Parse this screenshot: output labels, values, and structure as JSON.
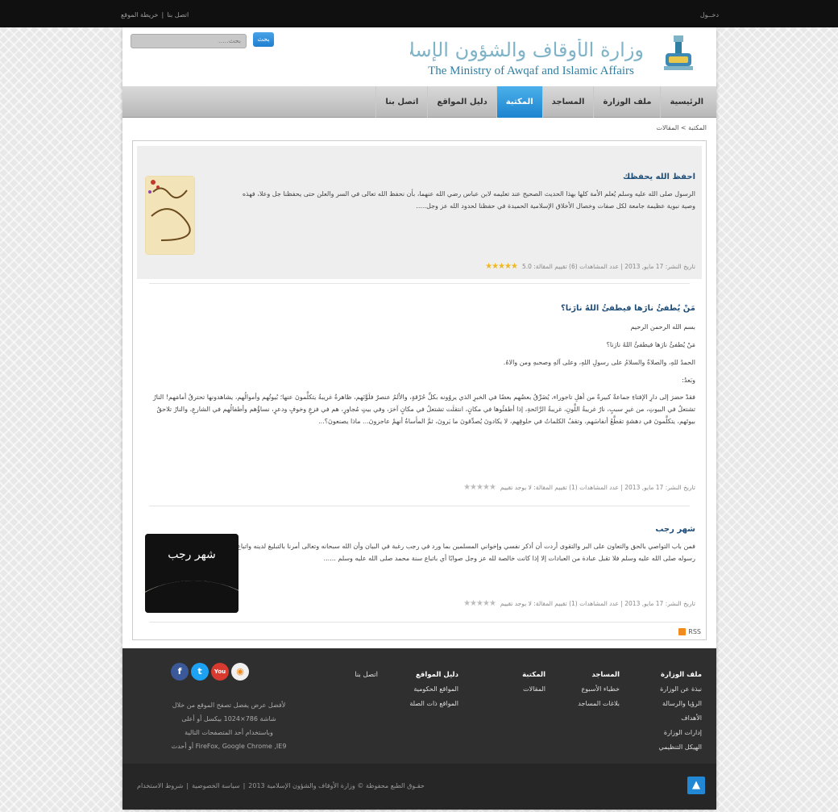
{
  "topbar": {
    "login": "دخــول",
    "links": [
      "اتصل بنا",
      "|",
      "خريطة الموقع"
    ]
  },
  "header": {
    "logo_ar": "وزارة الأوقاف والشؤون الإسلامية",
    "logo_en": "The Ministry of Awqaf and Islamic Affairs",
    "search_placeholder": "بحث.....",
    "search_button": "بحث"
  },
  "nav": {
    "items": [
      "الرئيسية",
      "ملف الوزارة",
      "المساجد",
      "المكتبة",
      "دليل المواقع",
      "اتصل بنا"
    ],
    "active_index": 3
  },
  "breadcrumb": "المكتبة > المقالات",
  "articles": [
    {
      "title": "احفظ الله يحفظك",
      "excerpt": "الرسول صلى الله عليه وسلم يُعلم الأمة كلها بهذا الحديث الصحيح عند تعليمه لابن عباس رضي الله عنهما، بأن نحفظ الله تعالى في السر والعلن حتى يحفظنا جل وعلا، فهذه وصية نبوية عظيمة جامعة لكل صفات وخصال الأخلاق الإسلامية الحميدة في حفظنا لحدود الله عز وجل.....",
      "meta": "تاريخ النشر: 17 مايو, 2013   |   عدد المشاهدات (6)   تقييم المقالة: 5.0",
      "rating": 5.0,
      "image_caption": "احفظ الله يحفظك"
    },
    {
      "title": "مَنْ يُطفئُ نارَها فيطفئُ اللهُ نارَنا؟",
      "paragraphs": [
        "بسم الله الرحمن الرحيم",
        "مَنْ يُطفئُ نارَها فيطفئُ اللهُ نارَنا؟",
        "الحمدُ للهِ، والصلاةُ والسلامُ على رسولِ اللهِ، وعلى آلهِ وصحبهِ ومن والاهُ.",
        "وبَعدُ:",
        "فقدْ حضرَ إلى دارِ الإفتاءِ جماعةٌ كبيرةٌ من أهلِ تاجوراء، يُضَرِّقُ بعضُهم بعضًا في الخبرِ الذي يروُونه بكلِّ حُرْقةٍ، والألمُ عنصرٌ فلَوَّنَهم، ظاهرةُ غريبةُ يتكلَّمونَ عنها؛ بُيوتُهم وأموالُهم، يشاهدونها تحترقُ أمامَهم! النارُ تشتعلُ في البيوتِ، من غيرِ سببٍ، نارٌ غريبةُ اللَّونِ، غريبةُ الرَّائحةِ، إذا أطفئُوها في مكانٍ، انتقلَت تشتعلُ في مكانٍ آخرَ، وفي بيتٍ مُجاورٍ، هم في فزعٍ وخوفٍ ودعرٍ، نساؤُهم وأطفالُهم في الشارعِ، والنارُ تلاحقُ بيوتَهم، يتكلَّمونَ في دهشةٍ تقطَّعُ أنفاسَهم، وتقفُ الكلماتُ في حلوقِهم، لا يكادونَ يُصدِّقونَ ما يَرونَ، ثمَّ المأساةُ أنهمْ عاجزونَ... ماذا يصنعونَ؟..."
      ],
      "meta": "تاريخ النشر: 17 مايو, 2013   |   عدد المشاهدات (1)   تقييم المقالة: لا يوجد تقييم",
      "rating": 0
    },
    {
      "title": "شهر رجب",
      "excerpt": "فمن باب التواصي بالحق والتعاون على البر والتقوى أردت أن أذكر نفسي وإخواني المسلمين بما ورد في رجب رغبة في البيان وأن الله سبحانه وتعالى أمرنا بالتبليغ لدينه واتباع رسوله صلى الله عليه وسلم فلا تقبل عبادة من العبادات إلا إذا كانت خالصة لله عز وجل صوابًا أي باتباع سنة محمد صلى الله عليه وسلم ......",
      "meta": "تاريخ النشر: 17 مايو, 2013   |   عدد المشاهدات (1)   تقييم المقالة: لا يوجد تقييم",
      "rating": 0,
      "image_caption": "شهر رجب"
    }
  ],
  "rss": "RSS",
  "footer": {
    "columns": [
      {
        "title": "ملف الوزارة",
        "items": [
          "نبذة عن الوزارة",
          "الرؤيا والرسالة",
          "الأهداف",
          "إدارات الوزارة",
          "الهيكل التنظيمي"
        ]
      },
      {
        "title": "المساجد",
        "items": [
          "خطباء الأسبوع",
          "بلاغات المساجد"
        ]
      },
      {
        "title": "المكتبة",
        "items": [
          "المقالات"
        ]
      },
      {
        "title": "دليل المواقع",
        "items": [
          "المواقع الحكومية",
          "المواقع ذات الصلة"
        ]
      },
      {
        "title": "اتصل بنا",
        "items": []
      }
    ],
    "browser_note": [
      "لأفضل عرض يفضل تصفح الموقع من خلال",
      "شاشة 786×1024 بيكسل أو أعلى",
      "وباستخدام أحد المتصفحات التالية",
      "FireFox, Google Chrome ,IE9 أو أحدث"
    ],
    "social": [
      "facebook-icon",
      "twitter-icon",
      "youtube-icon",
      "rss-social-icon"
    ]
  },
  "bottom": {
    "copyright": "حقـوق الطبع محفوظة © وزارة الأوقاف والشؤون الإسلامية 2013",
    "links": [
      "سياسة الخصوصية",
      "شروط الاستخدام"
    ]
  }
}
